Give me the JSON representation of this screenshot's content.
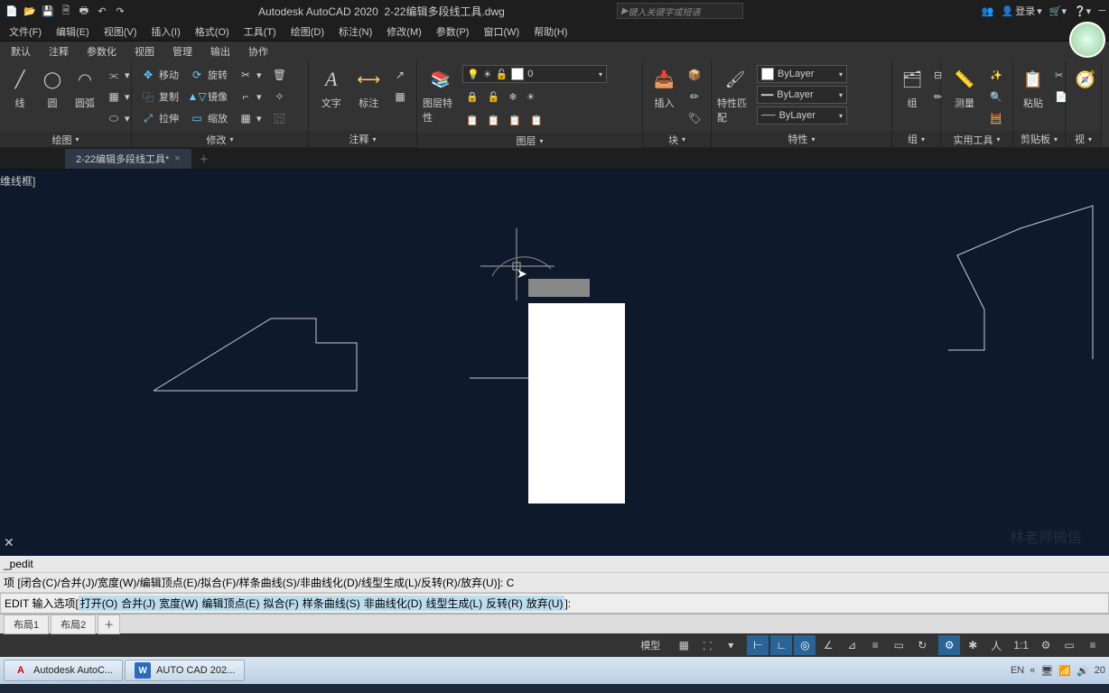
{
  "titlebar": {
    "app": "Autodesk AutoCAD 2020",
    "file": "2-22编辑多段线工具.dwg",
    "search_placeholder": "键入关键字或短语",
    "login": "登录"
  },
  "menubar": [
    "文件(F)",
    "编辑(E)",
    "视图(V)",
    "插入(I)",
    "格式(O)",
    "工具(T)",
    "绘图(D)",
    "标注(N)",
    "修改(M)",
    "参数(P)",
    "窗口(W)",
    "帮助(H)"
  ],
  "ribbon_tabs": [
    "默认",
    "注释",
    "参数化",
    "视图",
    "管理",
    "输出",
    "协作"
  ],
  "panels": {
    "draw": {
      "title": "绘图",
      "line": "线",
      "circle": "圆",
      "arc": "圆弧"
    },
    "modify": {
      "title": "修改",
      "move": "移动",
      "copy": "复制",
      "stretch": "拉伸",
      "rotate": "旋转",
      "mirror": "镜像",
      "scale": "缩放"
    },
    "annotate": {
      "title": "注释",
      "text": "文字",
      "dim": "标注"
    },
    "layer": {
      "title": "图层",
      "props": "图层特性",
      "current": "0"
    },
    "block": {
      "title": "块",
      "insert": "插入"
    },
    "props": {
      "title": "特性",
      "match": "特性匹配",
      "bylayer": "ByLayer"
    },
    "group": {
      "title": "组",
      "label": "组"
    },
    "util": {
      "title": "实用工具",
      "measure": "测量"
    },
    "clip": {
      "title": "剪贴板",
      "paste": "粘贴"
    },
    "view": {
      "title": "视"
    }
  },
  "doc_tab": "2-22编辑多段线工具*",
  "work_label": "维线框]",
  "watermark": "林老师微信",
  "cmd": {
    "hist1": "_pedit",
    "hist2": "项 [闭合(C)/合并(J)/宽度(W)/编辑顶点(E)/拟合(F)/样条曲线(S)/非曲线化(D)/线型生成(L)/反转(R)/放弃(U)]: C",
    "prompt_label": "EDIT 输入选项 ",
    "opt_open": "打开(O)",
    "opt_join": "合并(J)",
    "opt_width": "宽度(W)",
    "opt_edit": "编辑顶点(E)",
    "opt_fit": "拟合(F)",
    "opt_spline": "样条曲线(S)",
    "opt_decurve": "非曲线化(D)",
    "opt_ltgen": "线型生成(L)",
    "opt_rev": "反转(R)",
    "opt_undo": "放弃(U)"
  },
  "layout_tabs": {
    "t1": "布局1",
    "t2": "布局2"
  },
  "status": {
    "model": "模型",
    "scale": "1:1"
  },
  "taskbar": {
    "app1": "Autodesk AutoC...",
    "app2": "AUTO  CAD 202...",
    "lang": "EN",
    "time": "20"
  }
}
